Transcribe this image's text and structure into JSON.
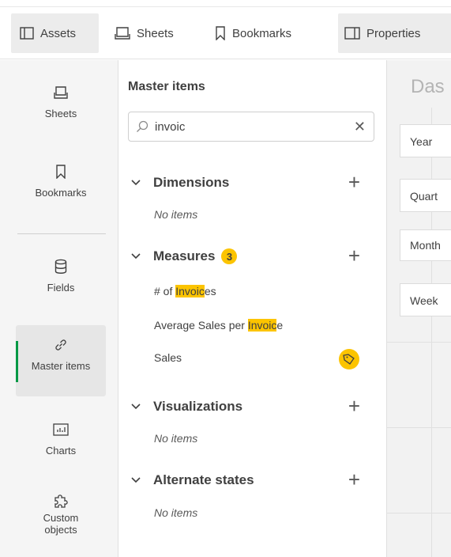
{
  "toolbar": {
    "tabs": [
      {
        "label": "Assets",
        "icon": "panel-left-icon",
        "active": true
      },
      {
        "label": "Sheets",
        "icon": "sheet-icon",
        "active": false
      },
      {
        "label": "Bookmarks",
        "icon": "bookmark-icon",
        "active": false
      },
      {
        "label": "Properties",
        "icon": "panel-right-icon",
        "active": true
      }
    ]
  },
  "leftnav": {
    "items": [
      {
        "label": "Sheets",
        "icon": "sheet-icon"
      },
      {
        "label": "Bookmarks",
        "icon": "bookmark-icon"
      },
      {
        "label": "Fields",
        "icon": "database-icon"
      },
      {
        "label": "Master items",
        "icon": "link-icon",
        "active": true
      },
      {
        "label": "Charts",
        "icon": "chart-icon"
      },
      {
        "label": "Custom objects",
        "label_line1": "Custom",
        "label_line2": "objects",
        "icon": "puzzle-icon"
      }
    ],
    "accent_color": "#009845"
  },
  "panel": {
    "title": "Master items",
    "search": {
      "value": "invoic",
      "placeholder": ""
    },
    "sections": [
      {
        "title": "Dimensions",
        "empty_label": "No items"
      },
      {
        "title": "Measures",
        "count": "3",
        "items": [
          {
            "pre": "# of ",
            "match": "Invoic",
            "post": "es"
          },
          {
            "pre": "Average Sales per ",
            "match": "Invoic",
            "post": "e"
          },
          {
            "pre": "Sales",
            "match": "",
            "post": "",
            "tagged": true
          }
        ]
      },
      {
        "title": "Visualizations",
        "empty_label": "No items"
      },
      {
        "title": "Alternate states",
        "empty_label": "No items"
      }
    ],
    "highlight_color": "#fcc400"
  },
  "sheet": {
    "title": "Das",
    "filters": [
      "Year",
      "Quart",
      "Month",
      "Week"
    ]
  }
}
